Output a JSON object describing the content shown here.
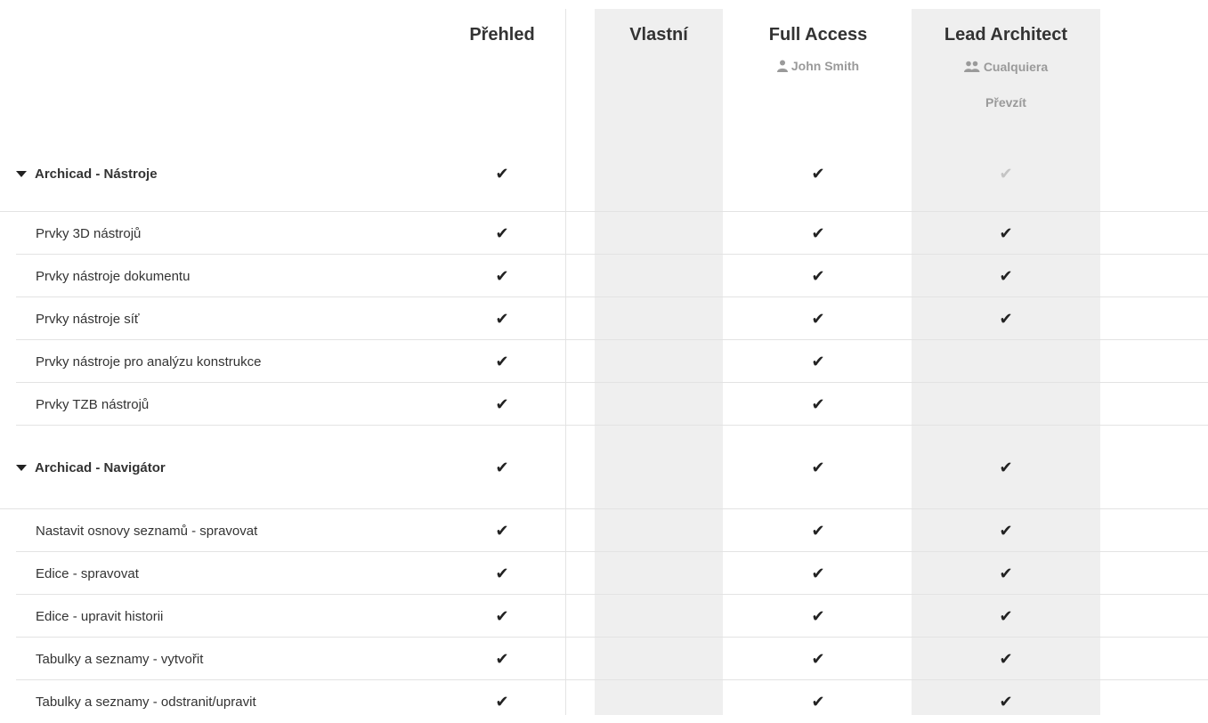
{
  "columns": [
    {
      "title": "Přehled"
    },
    {
      "title": "Vlastní"
    },
    {
      "title": "Full Access",
      "subtitle": "John Smith",
      "icon": "user-icon"
    },
    {
      "title": "Lead Architect",
      "subtitle": "Cualquiera",
      "icon": "users-icon",
      "action": "Převzít"
    }
  ],
  "check_glyph": "✔",
  "sections": [
    {
      "title": "Archicad - Nástroje",
      "checks": [
        true,
        false,
        true,
        "muted"
      ],
      "items": [
        {
          "label": "Prvky 3D nástrojů",
          "checks": [
            true,
            false,
            true,
            true
          ]
        },
        {
          "label": "Prvky nástroje dokumentu",
          "checks": [
            true,
            false,
            true,
            true
          ]
        },
        {
          "label": "Prvky nástroje síť",
          "checks": [
            true,
            false,
            true,
            true
          ]
        },
        {
          "label": "Prvky nástroje pro analýzu konstrukce",
          "checks": [
            true,
            false,
            true,
            false
          ]
        },
        {
          "label": "Prvky TZB nástrojů",
          "checks": [
            true,
            false,
            true,
            false
          ]
        }
      ]
    },
    {
      "title": "Archicad - Navigátor",
      "checks": [
        true,
        false,
        true,
        true
      ],
      "items": [
        {
          "label": "Nastavit osnovy seznamů - spravovat",
          "checks": [
            true,
            false,
            true,
            true
          ]
        },
        {
          "label": "Edice - spravovat",
          "checks": [
            true,
            false,
            true,
            true
          ]
        },
        {
          "label": "Edice - upravit historii",
          "checks": [
            true,
            false,
            true,
            true
          ]
        },
        {
          "label": "Tabulky a seznamy - vytvořit",
          "checks": [
            true,
            false,
            true,
            true
          ]
        },
        {
          "label": "Tabulky a seznamy - odstranit/upravit",
          "checks": [
            true,
            false,
            true,
            true
          ]
        }
      ]
    }
  ]
}
